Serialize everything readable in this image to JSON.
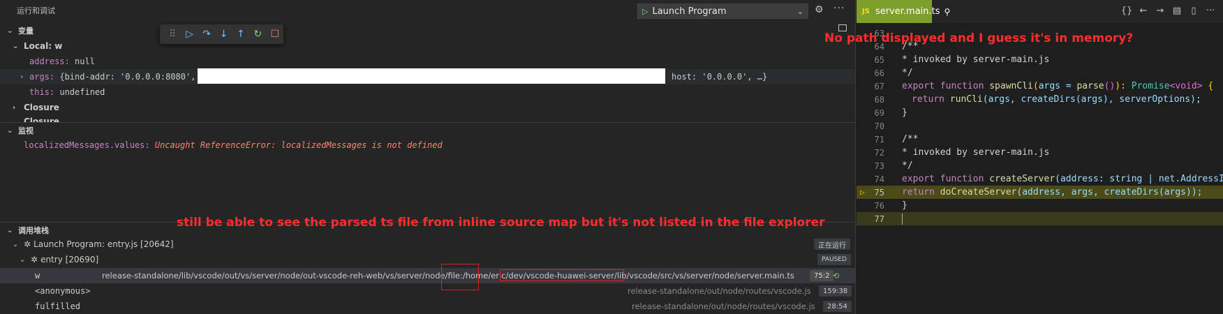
{
  "run_panel": {
    "title": "运行和调试",
    "launch_config": "Launch Program",
    "more": "···"
  },
  "variables": {
    "header": "变量",
    "local_label": "Local: w",
    "address_key": "address:",
    "address_val": "null",
    "args_key": "args:",
    "args_val": "{bind-addr: '0.0.0.0:8080',",
    "args_tail": "host: '0.0.0.0', …}",
    "this_key": "this:",
    "this_val": "undefined",
    "closure1": "Closure",
    "closure2": "Closure"
  },
  "watch": {
    "header": "监视",
    "expr": "localizedMessages.values:",
    "error": "Uncaught ReferenceError: localizedMessages is not defined"
  },
  "call_stack": {
    "header": "调用堆栈",
    "session": "Launch Program: entry.js [20642]",
    "session_badge": "正在运行",
    "thread": "entry [20690]",
    "thread_badge": "PAUSED",
    "frames": [
      {
        "name": "w",
        "path": "release-standalone/lib/vscode/out/vs/server/node/out-vscode-reh-web/vs/server/node/file:/home/eric/dev/vscode-huawei-server/lib/vscode/src/vs/server/node/server.main.ts",
        "pos": "75:2"
      },
      {
        "name": "<anonymous>",
        "path": "release-standalone/out/node/routes/vscode.js",
        "pos": "159:38"
      },
      {
        "name": "fulfilled",
        "path": "release-standalone/out/node/routes/vscode.js",
        "pos": "28:54"
      }
    ]
  },
  "annotations": {
    "top": "No path displayed and I guess it's in memory?",
    "middle": "still be able to see the parsed ts file from inline source map but it's not listed in the file explorer"
  },
  "editor": {
    "tab_badge": "JS",
    "tab_name": "server.main.ts",
    "actions": [
      "{}",
      "←",
      "→",
      "▤",
      "▯",
      "···"
    ],
    "line_numbers": [
      "63",
      "64",
      "65",
      "66",
      "67",
      "68",
      "69",
      "70",
      "71",
      "72",
      "73",
      "74",
      "75",
      "76",
      "77"
    ],
    "code": {
      "l64": "/**",
      "l65": " * invoked by server-main.js",
      "l66": " */",
      "l67_kw": "export function",
      "l67_fn": "spawnCli",
      "l67_a": "(",
      "l67_b": "args = ",
      "l67_c": "parse",
      "l67_d": "()",
      "l67_e": "): ",
      "l67_f": "Promise",
      "l67_g": "<void>",
      "l67_h": " {",
      "l68_kw": "return",
      "l68_fn": "runCli",
      "l68_rest": "(args, createDirs(args), serverOptions);",
      "l69": "}",
      "l71": "/**",
      "l72": " * invoked by server-main.js",
      "l73": " */",
      "l74_kw": "export function",
      "l74_fn": "createServer",
      "l74_rest": "(address: string | net.AddressIn",
      "l75_kw": "return",
      "l75_fn": "doCreateServer",
      "l75_rest": "(address, args, createDirs(args));",
      "l76": "}"
    }
  },
  "colors": {
    "accent_tab": "#7ea02a",
    "annotation": "#ff2d2d",
    "error_text": "#f48771",
    "current_line": "#4b4b18"
  }
}
